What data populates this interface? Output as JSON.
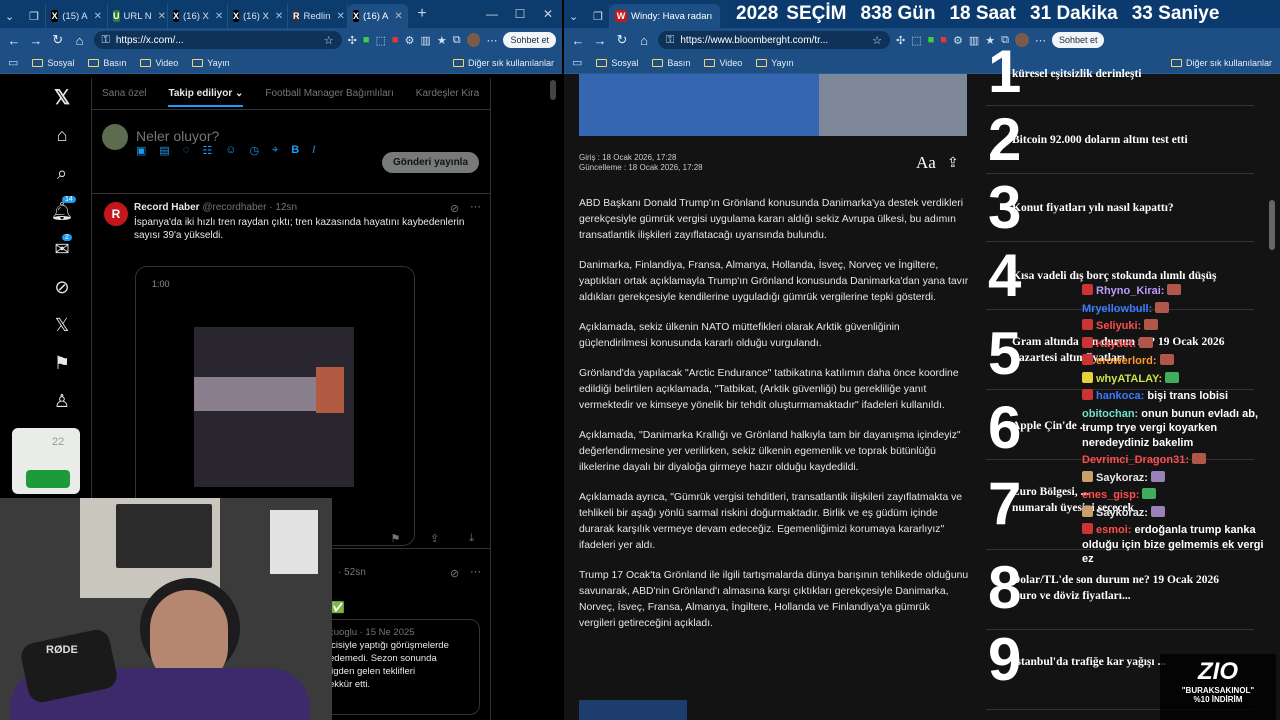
{
  "left_window": {
    "tabs": [
      {
        "label": "(15) A",
        "icon": "x-favicon"
      },
      {
        "label": "URL N",
        "icon": "url-favicon"
      },
      {
        "label": "(16) X",
        "icon": "x-favicon"
      },
      {
        "label": "(16) X",
        "icon": "x-favicon"
      },
      {
        "label": "Redlin",
        "icon": "r-favicon"
      },
      {
        "label": "(16) A",
        "icon": "x-favicon"
      }
    ],
    "url": "https://x.com/...",
    "chat_button": "Sohbet et",
    "bookmarks": [
      "Sosyal",
      "Basın",
      "Video",
      "Yayın"
    ],
    "bookmarks_other": "Diğer sık kullanılanlar"
  },
  "x": {
    "tabs": [
      "Sana özel",
      "Takip ediliyor",
      "Football Manager Bağımlıları",
      "Kardeşler Kira"
    ],
    "active_tab": "Takip ediliyor",
    "compose_placeholder": "Neler oluyor?",
    "post_button": "Gönderi yayınla",
    "notif_badge": "14",
    "msg_badge": "2",
    "post1": {
      "name": "Record Haber",
      "handle": "@recordhaber",
      "time": "12sn",
      "text": "İspanya'da iki hızlı tren raydan çıktı; tren kazasında hayatını kaybedenlerin sayısı 39'a yükseldi.",
      "video_time": "1:00"
    },
    "post2": {
      "time": "52sn",
      "partial_text": "...✅",
      "quote_meta": "cuoglu · 15 Ne 2025",
      "quote_lines": [
        "lcisiyle yaptığı görüşmelerde",
        "edemedi. Sezon sonunda",
        "ligden gelen teklifleri",
        "ekkür etti."
      ]
    },
    "widget_count": "22"
  },
  "webcam": {
    "mic_brand": "RØDE"
  },
  "right_window": {
    "tab_label": "Windy: Hava radarı",
    "url": "https://www.bloomberght.com/tr...",
    "chat_button": "Sohbet et",
    "bookmarks": [
      "Sosyal",
      "Basın",
      "Video",
      "Yayın"
    ],
    "bookmarks_other": "Diğer sık kullanılanlar"
  },
  "countdown": {
    "year": "2028",
    "label": "SEÇİM",
    "days": "838",
    "days_label": "Gün",
    "hours": "18",
    "hours_label": "Saat",
    "minutes": "31",
    "minutes_label": "Dakika",
    "seconds": "33",
    "seconds_label": "Saniye"
  },
  "article": {
    "meta_published": "Giriş : 18 Ocak 2026, 17:28",
    "meta_updated": "Güncelleme : 18 Ocak 2026, 17:28",
    "font_btn": "Aa",
    "paragraphs": [
      "ABD Başkanı Donald Trump'ın Grönland konusunda Danimarka'ya destek verdikleri gerekçesiyle gümrük vergisi uygulama kararı aldığı sekiz Avrupa ülkesi, bu adımın transatlantik ilişkileri zayıflatacağı uyarısında bulundu.",
      "Danimarka, Finlandiya, Fransa, Almanya, Hollanda, İsveç, Norveç ve İngiltere, yaptıkları ortak açıklamayla Trump'ın Grönland konusunda Danimarka'dan yana tavır aldıkları gerekçesiyle kendilerine uyguladığı gümrük vergilerine tepki gösterdi.",
      "Açıklamada, sekiz ülkenin NATO müttefikleri olarak Arktik güvenliğinin güçlendirilmesi konusunda kararlı olduğu vurgulandı.",
      "Grönland'da yapılacak \"Arctic Endurance\" tatbikatına katılımın daha önce koordine edildiği belirtilen açıklamada, \"Tatbikat, (Arktik güvenliği) bu gerekliliğe yanıt vermektedir ve kimseye yönelik bir tehdit oluşturmamaktadır\" ifadeleri kullanıldı.",
      "Açıklamada, \"Danimarka Krallığı ve Grönland halkıyla tam bir dayanışma içindeyiz\" değerlendirmesine yer verilirken, sekiz ülkenin egemenlik ve toprak bütünlüğü ilkelerine dayalı bir diyaloğa girmeye hazır olduğu kaydedildi.",
      "Açıklamada ayrıca, \"Gümrük vergisi tehditleri, transatlantik ilişkileri zayıflatmakta ve tehlikeli bir aşağı yönlü sarmal riskini doğurmaktadır. Birlik ve eş güdüm içinde durarak karşılık vermeye devam edeceğiz. Egemenliğimizi korumaya kararlıyız\" ifadeleri yer aldı.",
      "Trump 17 Ocak'ta Grönland ile ilgili tartışmalarda dünya barışının tehlikede olduğunu savunarak, ABD'nin Grönland'ı almasına karşı çıktıkları gerekçesiyle Danimarka, Norveç, İsveç, Fransa, Almanya, İngiltere, Hollanda ve Finlandiya'ya gümrük vergileri getireceğini açıkladı."
    ]
  },
  "most_read": [
    {
      "num": "1",
      "title": "küresel eşitsizlik derinleşti"
    },
    {
      "num": "2",
      "title": "Bitcoin 92.000 doların altını test etti"
    },
    {
      "num": "3",
      "title": "Konut fiyatları yılı nasıl kapattı?"
    },
    {
      "num": "4",
      "title": "Kısa vadeli dış borç stokunda ılımlı düşüş"
    },
    {
      "num": "5",
      "title": "Gram altında son durum ne? 19 Ocak 2026",
      "title2": "Pazartesi altın fiyatları"
    },
    {
      "num": "6",
      "title": "Apple Çin'de ..."
    },
    {
      "num": "7",
      "title": "Euro Bölgesi, ...",
      "title2": "numaralı üyesini seçecek"
    },
    {
      "num": "8",
      "title": "Dolar/TL'de son durum ne? 19 Ocak 2026",
      "title2": "Euro ve döviz fiyatları..."
    },
    {
      "num": "9",
      "title": "İstanbul'da trafiğe kar yağışı ..."
    }
  ],
  "chat": [
    {
      "user": "Rhyno_Kirai:",
      "msg": "",
      "color": "#b99bff",
      "emote": true
    },
    {
      "user": "Mryellowbull:",
      "msg": "",
      "color": "#3a7bff",
      "emote": true
    },
    {
      "user": "Seliyuki:",
      "msg": "",
      "color": "#ff4d4d",
      "emote": true
    },
    {
      "user": "Kaydet:",
      "msg": "",
      "color": "#ff4d4d",
      "emote": true
    },
    {
      "user": "erowerlord:",
      "msg": "",
      "color": "#ff9a2e",
      "emote": true
    },
    {
      "user": "whyATALAY:",
      "msg": "",
      "color": "#c8e34a",
      "emote": true
    },
    {
      "user": "hankoca:",
      "msg": "bişi trans lobisi",
      "color": "#3a7bff",
      "emote": false
    },
    {
      "user": "obitochan:",
      "msg": "onun bunun evladı ab, trump trye vergi koyarken neredeydiniz bakelim",
      "color": "#6fe0d0",
      "emote": false
    },
    {
      "user": "Devrimci_Dragon31:",
      "msg": "",
      "color": "#ff4d4d",
      "emote": true
    },
    {
      "user": "Saykoraz:",
      "msg": "",
      "color": "#e7e7e7",
      "emote": true
    },
    {
      "user": "enes_gisp:",
      "msg": "",
      "color": "#ff4d4d",
      "emote": true
    },
    {
      "user": "Saykoraz:",
      "msg": "",
      "color": "#e7e7e7",
      "emote": true
    },
    {
      "user": "esmoi:",
      "msg": "erdoğanla trump kanka olduğu için bize gelmemis ek vergi ez",
      "color": "#ff4d4d",
      "emote": false
    }
  ],
  "promo": {
    "brand": "ZIO",
    "code": "\"BURAKSAKINOL\"",
    "discount": "%10 İNDİRİM"
  }
}
